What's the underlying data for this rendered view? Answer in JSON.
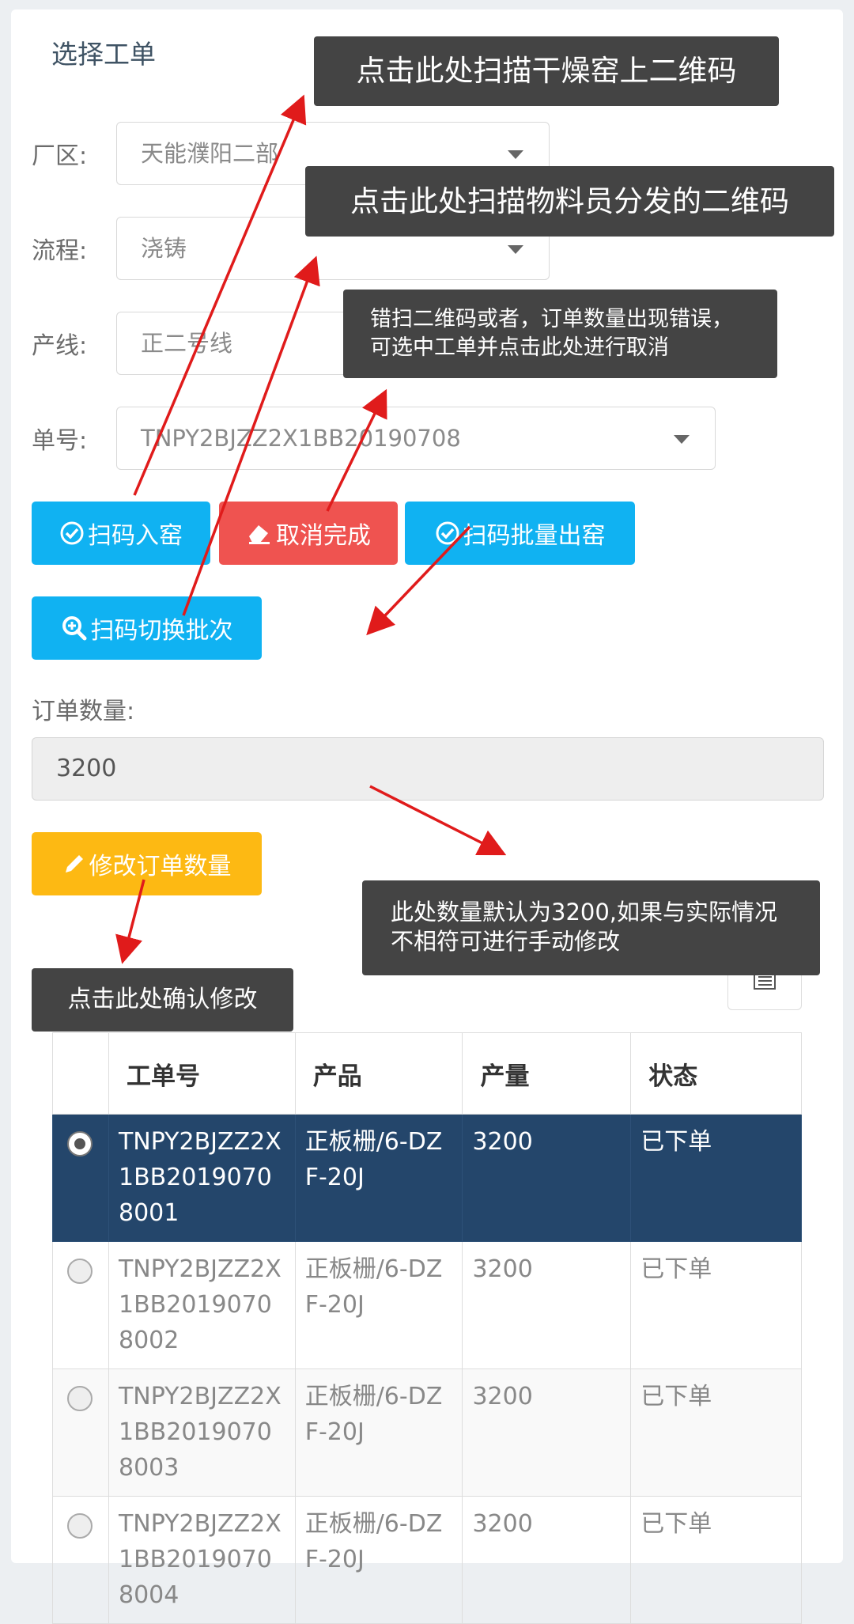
{
  "panel": {
    "title": "选择工单"
  },
  "fields": {
    "factory": {
      "label": "厂区:",
      "value": "天能濮阳二部"
    },
    "process": {
      "label": "流程:",
      "value": "浇铸"
    },
    "line": {
      "label": "产线:",
      "value": "正二号线"
    },
    "order": {
      "label": "单号:",
      "value": "TNPY2BJZZ2X1BB20190708"
    }
  },
  "buttons": {
    "scan_in": "扫码入窑",
    "cancel_complete": "取消完成",
    "scan_batch_out": "扫码批量出窑",
    "scan_switch_batch": "扫码切换批次",
    "modify_qty": "修改订单数量"
  },
  "quantity": {
    "label": "订单数量:",
    "value": "3200"
  },
  "table": {
    "headers": [
      "工单号",
      "产品",
      "产量",
      "状态"
    ],
    "rows": [
      {
        "order": "TNPY2BJZZ2X1BB20190708001",
        "product": "正板栅/6-DZF-20J",
        "qty": "3200",
        "status": "已下单",
        "selected": true
      },
      {
        "order": "TNPY2BJZZ2X1BB20190708002",
        "product": "正板栅/6-DZF-20J",
        "qty": "3200",
        "status": "已下单",
        "selected": false
      },
      {
        "order": "TNPY2BJZZ2X1BB20190708003",
        "product": "正板栅/6-DZF-20J",
        "qty": "3200",
        "status": "已下单",
        "selected": false
      },
      {
        "order": "TNPY2BJZZ2X1BB20190708004",
        "product": "正板栅/6-DZF-20J",
        "qty": "3200",
        "status": "已下单",
        "selected": false
      }
    ]
  },
  "annotations": {
    "scan_kiln": "点击此处扫描干燥窑上二维码",
    "scan_material": "点击此处扫描物料员分发的二维码",
    "cancel_hint": "错扫二维码或者，订单数量出现错误，可选中工单并点击此处进行取消",
    "qty_hint": "此处数量默认为3200,如果与实际情况不相符可进行手动修改",
    "confirm_hint": "点击此处确认修改"
  },
  "colors": {
    "primary": "#10b2f2",
    "danger": "#ef5350",
    "warning": "#fdb913",
    "selected_row": "#24466b",
    "annotation_bg": "#444444",
    "arrow": "#e01b1b"
  }
}
